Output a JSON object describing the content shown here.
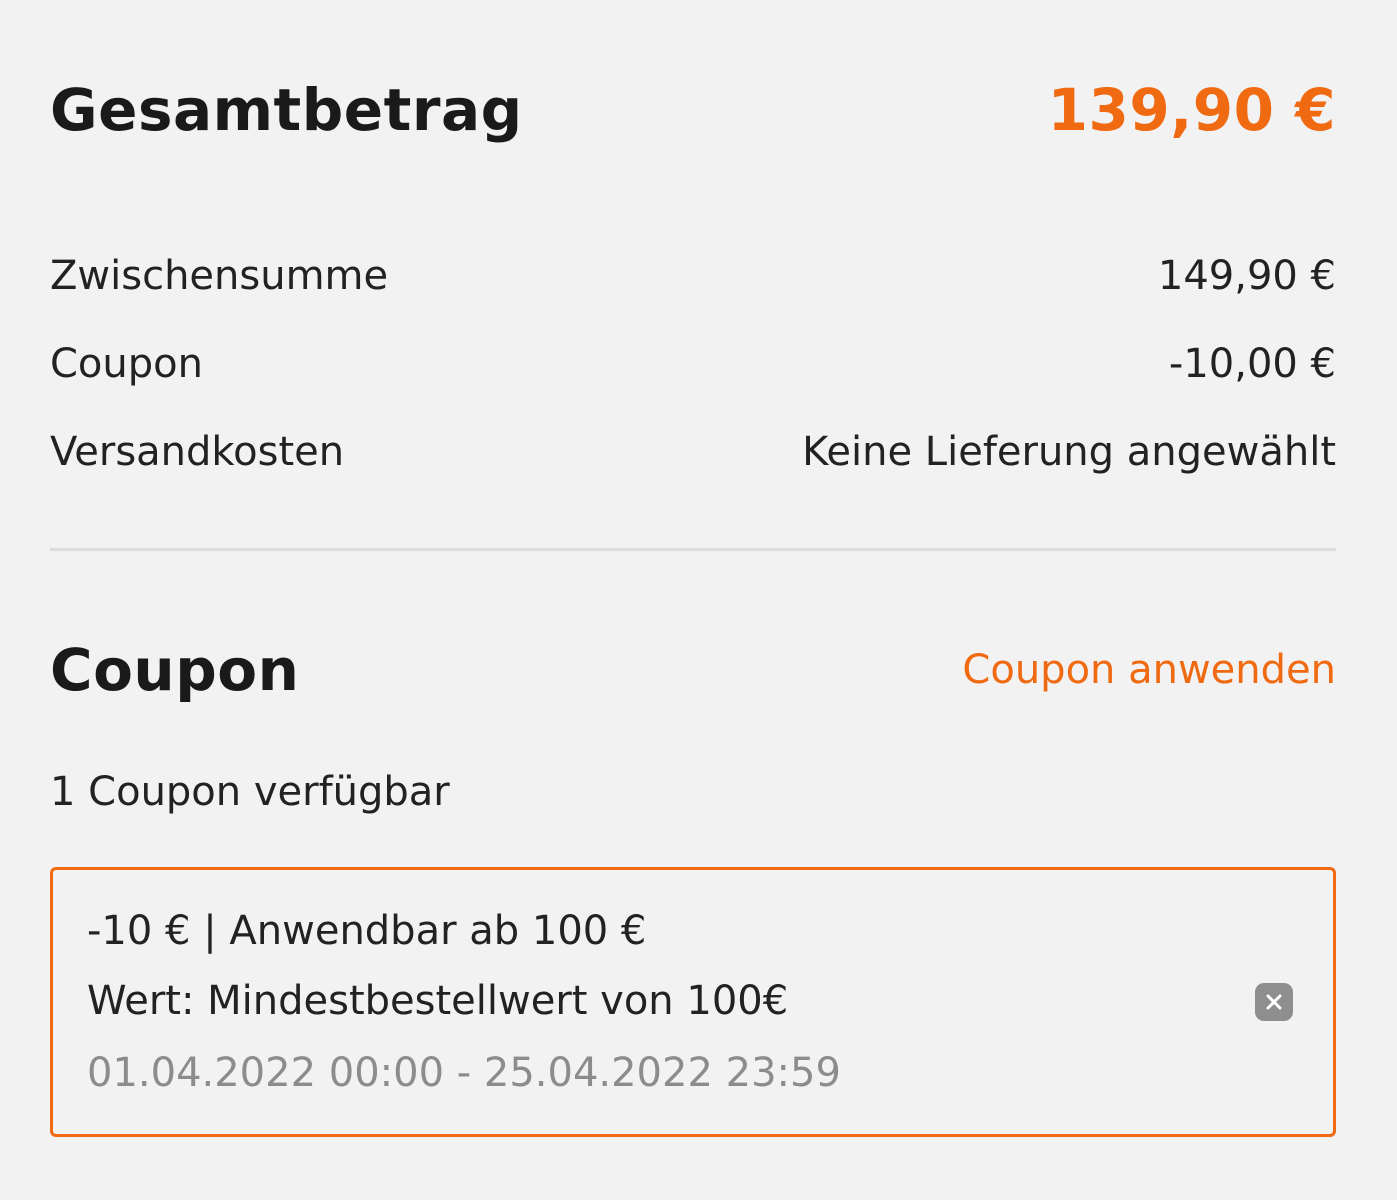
{
  "colors": {
    "accent": "#f06a12",
    "text": "#1e1e1e",
    "muted": "#8c8c8c",
    "background": "#f2f2f2"
  },
  "total": {
    "label": "Gesamtbetrag",
    "value": "139,90 €"
  },
  "summary": {
    "rows": [
      {
        "label": "Zwischensumme",
        "value": "149,90 €"
      },
      {
        "label": "Coupon",
        "value": "-10,00 €"
      },
      {
        "label": "Versandkosten",
        "value": "Keine Lieferung angewählt"
      }
    ]
  },
  "coupon_section": {
    "title": "Coupon",
    "apply_link": "Coupon anwenden",
    "available_text": "1 Coupon verfügbar",
    "card": {
      "headline": "-10 € | Anwendbar ab 100 €",
      "value_text": "Wert: Mindestbestellwert von 100€",
      "validity": "01.04.2022 00:00 - 25.04.2022 23:59",
      "remove_icon": "close-icon"
    }
  }
}
